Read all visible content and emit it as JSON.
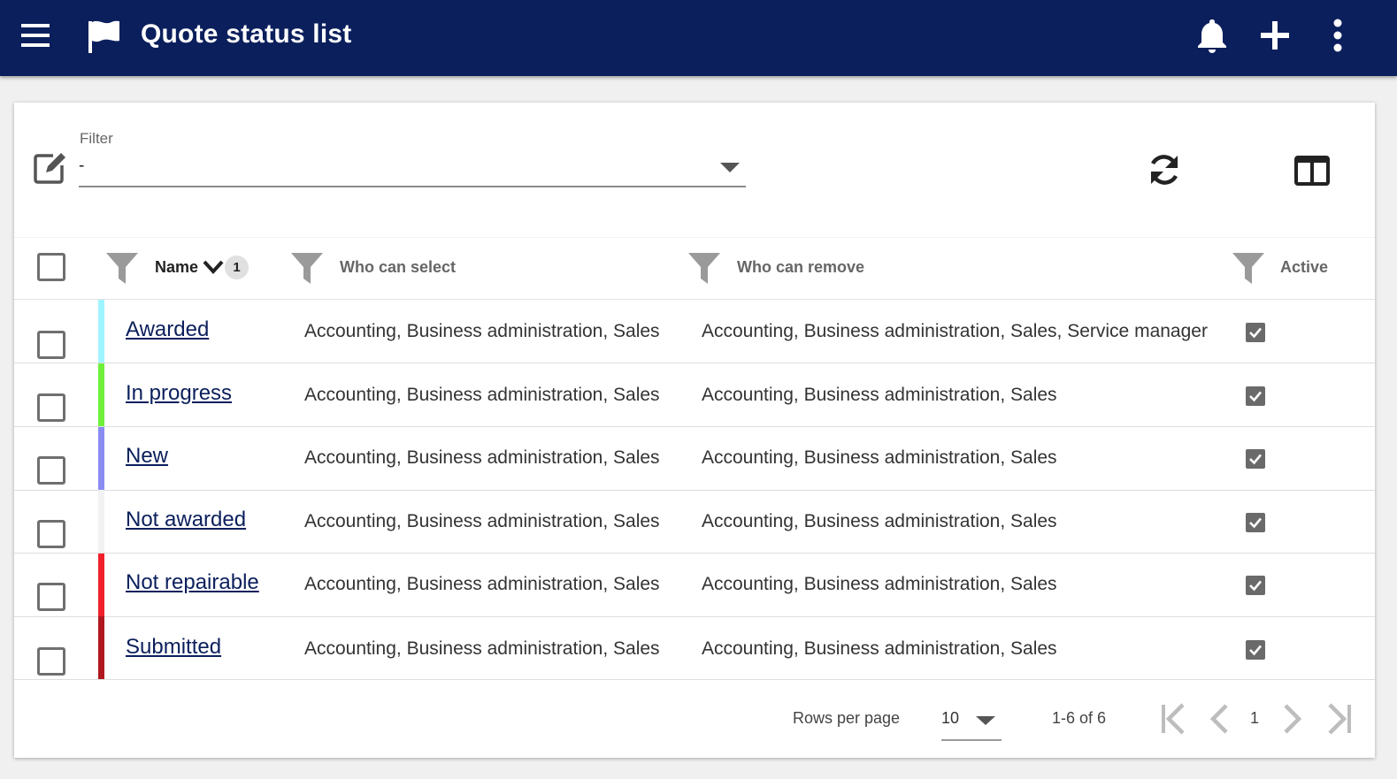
{
  "appbar": {
    "title": "Quote status list",
    "icons": [
      "menu-icon",
      "flag-icon",
      "bell-icon",
      "plus-icon",
      "more-vert-icon"
    ]
  },
  "filter": {
    "label": "Filter",
    "value": "-"
  },
  "table": {
    "columns": {
      "name": "Name",
      "sort_order": "1",
      "who_can_select": "Who can select",
      "who_can_remove": "Who can remove",
      "active": "Active"
    },
    "rows": [
      {
        "name": "Awarded",
        "color": "#9ff5ff",
        "who_can_select": "Accounting, Business administration, Sales",
        "who_can_remove": "Accounting, Business administration, Sales, Service manager",
        "active": true
      },
      {
        "name": "In progress",
        "color": "#6ef03a",
        "who_can_select": "Accounting, Business administration, Sales",
        "who_can_remove": "Accounting, Business administration, Sales",
        "active": true
      },
      {
        "name": "New",
        "color": "#8a8cf2",
        "who_can_select": "Accounting, Business administration, Sales",
        "who_can_remove": "Accounting, Business administration, Sales",
        "active": true
      },
      {
        "name": "Not awarded",
        "color": "#f2f2f2",
        "who_can_select": "Accounting, Business administration, Sales",
        "who_can_remove": "Accounting, Business administration, Sales",
        "active": true
      },
      {
        "name": "Not repairable",
        "color": "#f0202a",
        "who_can_select": "Accounting, Business administration, Sales",
        "who_can_remove": "Accounting, Business administration, Sales",
        "active": true
      },
      {
        "name": "Submitted",
        "color": "#b01820",
        "who_can_select": "Accounting, Business administration, Sales",
        "who_can_remove": "Accounting, Business administration, Sales",
        "active": true
      }
    ]
  },
  "pager": {
    "rows_per_page_label": "Rows per page",
    "rows_per_page_value": "10",
    "range": "1-6 of 6",
    "page": "1"
  },
  "colors": {
    "appbar": "#0b1f5c",
    "link": "#0b1f5c"
  }
}
